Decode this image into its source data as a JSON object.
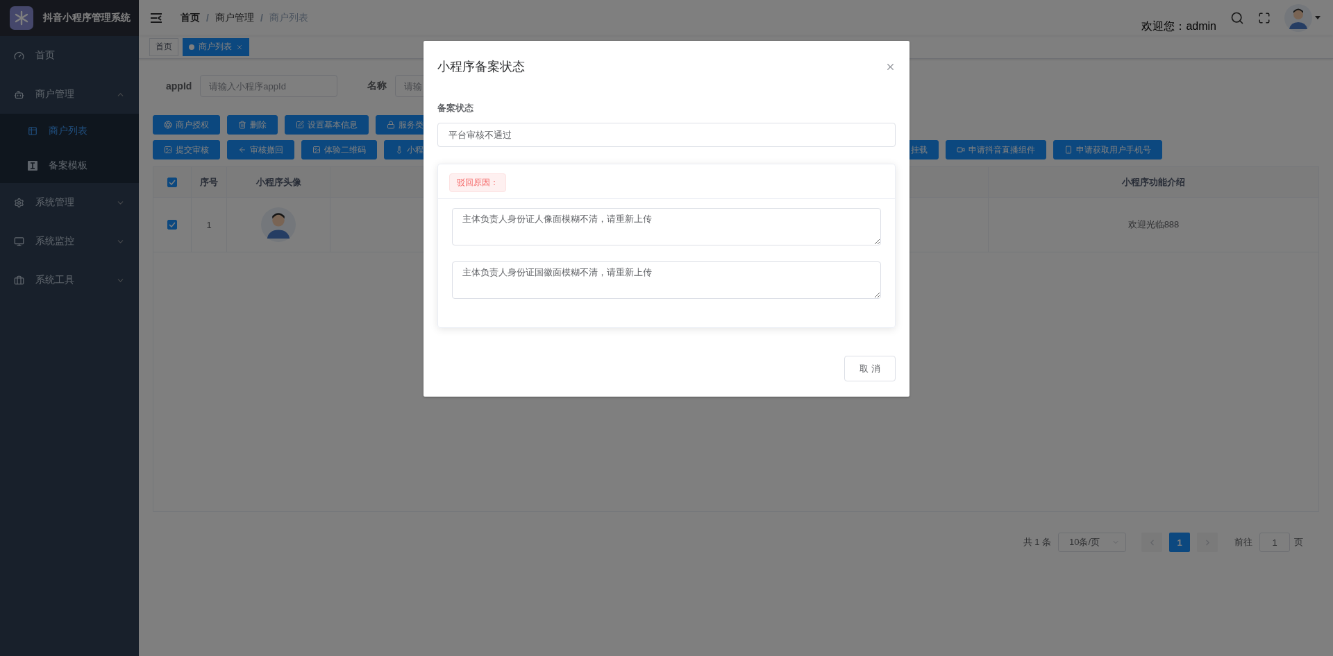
{
  "sidebar": {
    "title": "抖音小程序管理系统",
    "items": [
      {
        "label": "首页",
        "kind": "link"
      },
      {
        "label": "商户管理",
        "kind": "group",
        "expanded": true,
        "children": [
          {
            "label": "商户列表",
            "selected": true
          },
          {
            "label": "备案模板",
            "selected": false
          }
        ]
      },
      {
        "label": "系统管理",
        "kind": "group",
        "expanded": false
      },
      {
        "label": "系统监控",
        "kind": "group",
        "expanded": false
      },
      {
        "label": "系统工具",
        "kind": "group",
        "expanded": false
      }
    ]
  },
  "header": {
    "breadcrumb": [
      "首页",
      "商户管理",
      "商户列表"
    ],
    "separator": "/",
    "welcome": "欢迎您：admin"
  },
  "tags": [
    {
      "label": "首页",
      "selected": false
    },
    {
      "label": "商户列表",
      "selected": true
    }
  ],
  "search": {
    "fields": [
      {
        "label": "appId",
        "placeholder": "请输入小程序appId"
      },
      {
        "label": "名称",
        "placeholder": "请输"
      }
    ]
  },
  "toolbar": {
    "rows": [
      [
        "商户授权",
        "删除",
        "设置基本信息",
        "服务类"
      ],
      [
        "提交审核",
        "审核撤回",
        "体验二维码",
        "小程"
      ]
    ],
    "right_buttons": [
      "挂载",
      "申请抖音直播组件",
      "申请获取用户手机号"
    ]
  },
  "table": {
    "all_checked": true,
    "columns": [
      "序号",
      "小程序头像",
      "小程序功能介绍"
    ],
    "rows": [
      {
        "checked": true,
        "index": "1",
        "intro": "欢迎光临888"
      }
    ]
  },
  "pagination": {
    "total": "共 1 条",
    "page_size": "10条/页",
    "pages": [
      {
        "label": "1",
        "selected": true
      }
    ],
    "goto_label": "前往",
    "goto_value": "1",
    "goto_suffix": "页"
  },
  "dialog": {
    "title": "小程序备案状态",
    "status_label": "备案状态",
    "status_value": "平台审核不通过",
    "reason_tag": "驳回原因：",
    "reasons": [
      "主体负责人身份证人像面模糊不清，请重新上传",
      "主体负责人身份证国徽面模糊不清，请重新上传"
    ],
    "cancel": "取 消"
  }
}
